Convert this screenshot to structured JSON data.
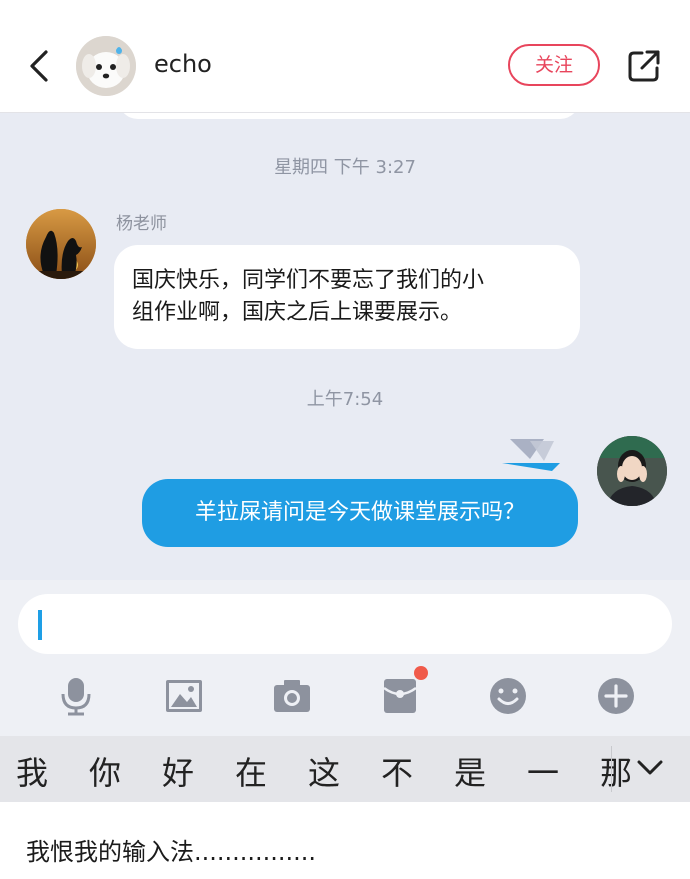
{
  "header": {
    "title": "echo",
    "follow_label": "关注"
  },
  "chat": {
    "time_1": "星期四 下午 3:27",
    "sender_name": "杨老师",
    "message_1_line_1": "国庆快乐，同学们不要忘了我们的小",
    "message_1_line_2": "组作业啊，国庆之后上课要展示。",
    "time_2": "上午7:54",
    "message_2": "羊拉屎请问是今天做课堂展示吗？"
  },
  "toolbar": {
    "icons": [
      "microphone-icon",
      "image-icon",
      "camera-icon",
      "red-packet-icon",
      "emoji-icon",
      "plus-icon"
    ]
  },
  "keyboard": {
    "candidates": [
      "我",
      "你",
      "好",
      "在",
      "这",
      "不",
      "是",
      "一",
      "那"
    ]
  },
  "caption": "我恨我的输入法................",
  "colors": {
    "accent_blue": "#1f9de3",
    "follow_red": "#e8455c",
    "chat_bg": "#e8ebf3"
  }
}
